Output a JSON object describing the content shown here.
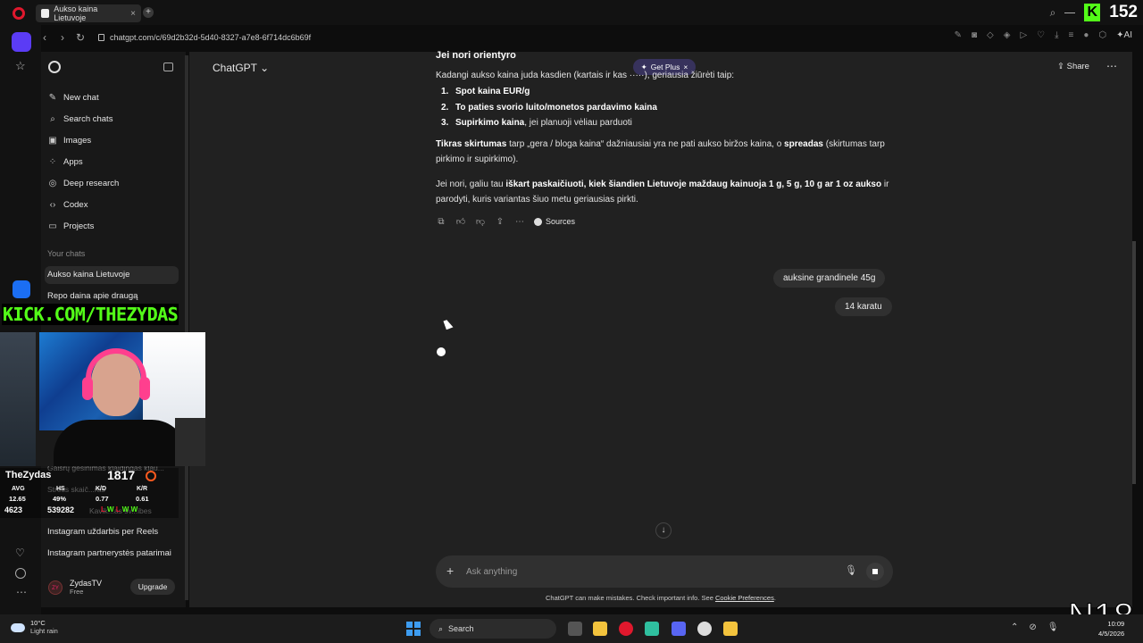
{
  "browser": {
    "tab_title": "Aukso kaina Lietuvoje",
    "url": "chatgpt.com/c/69d2b32d-5d40-8327-a7e8-6f714dc6b69f",
    "ai_label": "AI"
  },
  "stream": {
    "viewer_count": "152",
    "kick_url": "KICK.COM/THEZYDAS",
    "rating_badge": "N18",
    "player": {
      "name": "TheZydas",
      "elo": "1817",
      "headers": [
        "AVG",
        "HS",
        "K/D",
        "K/R"
      ],
      "values": [
        "12.65",
        "49%",
        "0.77",
        "0.61"
      ],
      "matches": "4623",
      "points": "539282",
      "results": [
        "L",
        "W",
        "L",
        "W",
        "W"
      ]
    }
  },
  "sidebar": {
    "nav": [
      {
        "label": "New chat",
        "icon": "edit-icon"
      },
      {
        "label": "Search chats",
        "icon": "search-icon"
      },
      {
        "label": "Images",
        "icon": "image-icon"
      },
      {
        "label": "Apps",
        "icon": "apps-icon"
      },
      {
        "label": "Deep research",
        "icon": "telescope-icon"
      },
      {
        "label": "Codex",
        "icon": "code-icon"
      },
      {
        "label": "Projects",
        "icon": "folder-icon"
      }
    ],
    "section_label": "Your chats",
    "chats": [
      "Aukso kaina Lietuvoje",
      "Repo daina apie draugą",
      "Instagram uždarbis per Reels",
      "Instagram partnerystės patarimai"
    ],
    "partial_chats": [
      "Gaisrų gesinimas klaidingas klau...",
      "Stress skaič...ras",
      "Kavik...as sv...ibes"
    ],
    "user": {
      "name": "ZydasTV",
      "plan": "Free",
      "initials": "ZY",
      "upgrade_label": "Upgrade"
    }
  },
  "header": {
    "model": "ChatGPT",
    "get_plus": "Get Plus",
    "share": "Share"
  },
  "conversation": {
    "heading": "Jei nori orientyro",
    "intro_pre": "Kadangi aukso kaina juda kasdien (kartais ir kas ",
    "intro_post": "), geriausia žiūrėti taip:",
    "list": [
      {
        "num": "1.",
        "bold": "Spot kaina EUR/g",
        "rest": ""
      },
      {
        "num": "2.",
        "bold": "To paties svorio luito/monetos pardavimo kaina",
        "rest": ""
      },
      {
        "num": "3.",
        "bold": "Supirkimo kaina",
        "rest": ", jei planuoji vėliau parduoti"
      }
    ],
    "para1": {
      "b1": "Tikras skirtumas",
      "t1": " tarp „gera / bloga kaina“ dažniausiai yra ne pati aukso biržos kaina, o ",
      "b2": "spreadas",
      "t2": " (skirtumas tarp pirkimo ir supirkimo)."
    },
    "para2": {
      "t1": "Jei nori, galiu tau ",
      "b1": "iškart paskaičiuoti, kiek šiandien Lietuvoje maždaug kainuoja 1 g, 5 g, 10 g ar 1 oz aukso",
      "t2": " ir parodyti, kuris variantas šiuo metu geriausias pirkti."
    },
    "sources_label": "Sources",
    "user_messages": [
      "auksine grandinele 45g",
      "14 karatu"
    ]
  },
  "composer": {
    "placeholder": "Ask anything",
    "disclaimer": "ChatGPT can make mistakes. Check important info. See ",
    "disclaimer_link": "Cookie Preferences",
    "disclaimer_end": "."
  },
  "taskbar": {
    "weather_temp": "10°C",
    "weather_desc": "Light rain",
    "search": "Search",
    "time": "10:09",
    "date": "4/5/2026"
  }
}
